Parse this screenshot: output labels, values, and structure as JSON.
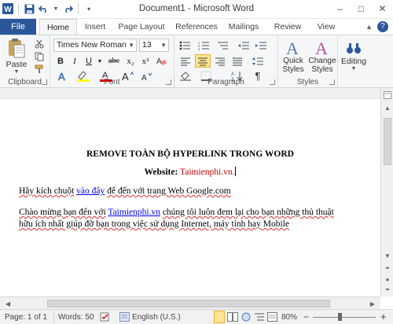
{
  "window": {
    "title": "Document1 - Microsoft Word"
  },
  "qat": {
    "app_icon": "word-logo-icon",
    "save": "save-icon",
    "undo": "undo-icon",
    "redo": "redo-icon",
    "customize": "chevron-down-icon"
  },
  "window_controls": {
    "minimize": "–",
    "maximize": "□",
    "close": "✕"
  },
  "tabs": [
    {
      "label": "File"
    },
    {
      "label": "Home"
    },
    {
      "label": "Insert"
    },
    {
      "label": "Page Layout"
    },
    {
      "label": "References"
    },
    {
      "label": "Mailings"
    },
    {
      "label": "Review"
    },
    {
      "label": "View"
    }
  ],
  "ribbon": {
    "clipboard": {
      "label": "Clipboard",
      "paste": "Paste"
    },
    "font": {
      "label": "Font",
      "family": "Times New Roman",
      "size": "13",
      "grow": "A",
      "shrink": "A",
      "clear": "Aa",
      "bold": "B",
      "italic": "I",
      "underline": "U",
      "strike": "abc",
      "subscript": "x₂",
      "superscript": "x²",
      "color_letter": "A",
      "highlight_letter": "ab"
    },
    "paragraph": {
      "label": "Paragraph",
      "pilcrow": "¶"
    },
    "styles": {
      "label": "Styles",
      "quick": "Quick",
      "quick2": "Styles",
      "change": "Change",
      "change2": "Styles"
    },
    "editing": {
      "label": "Editing"
    }
  },
  "document": {
    "heading": "REMOVE TOÀN BỘ HYPERLINK TRONG WORD",
    "website_label": "Website",
    "website_colon": ":",
    "website_value": "Taimienphi.vn.",
    "line3_a": "Hãy kích chuột",
    "line3_link": "vào đây",
    "line3_b": "để đến với trang Web Google.com",
    "line4_a": "Chào mừng bạn đến với",
    "line4_link": "Taimienphi.vn",
    "line4_b": "chúng tôi luôn đem lại cho bạn những thủ thuật",
    "line5": "hữu ích nhất giúp đỡ bạn trong việc sử dụng Internet, máy tính hay Mobile"
  },
  "statusbar": {
    "page": "Page: 1 of 1",
    "words": "Words: 50",
    "language": "English (U.S.)",
    "zoom": "80%",
    "zoom_minus": "−",
    "zoom_plus": "+"
  },
  "colors": {
    "accent": "#2b579a",
    "link": "#0000ee",
    "website": "#c00000"
  }
}
